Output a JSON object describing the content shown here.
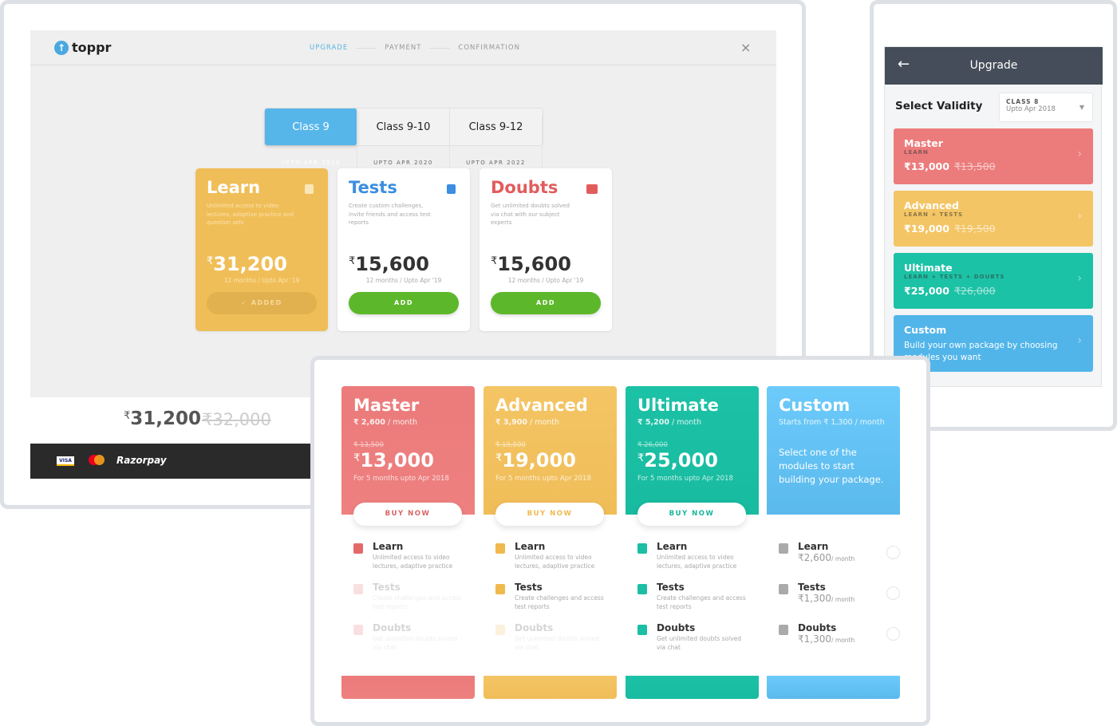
{
  "colors": {
    "master": "#ec7b7b",
    "advanced": "#f2c15e",
    "ultimate": "#1cc2a6",
    "custom": "#5cbdf0",
    "add_green": "#5cb82a",
    "accent_blue": "#56b6ea",
    "mobile_header": "#444d59"
  },
  "desktop": {
    "logo": "toppr",
    "steps": [
      {
        "label": "UPGRADE",
        "active": true
      },
      {
        "label": "PAYMENT",
        "active": false
      },
      {
        "label": "CONFIRMATION",
        "active": false
      }
    ],
    "close_icon": "×",
    "class_tabs": [
      {
        "title": "Class 9",
        "subtitle": "UPTO APR 2019",
        "selected": true
      },
      {
        "title": "Class 9-10",
        "subtitle": "UPTO APR 2020",
        "selected": false
      },
      {
        "title": "Class 9-12",
        "subtitle": "UPTO APR 2022",
        "selected": false
      }
    ],
    "modules": [
      {
        "title": "Learn",
        "icon": "book-icon",
        "description": "Unlimited access to video lectures, adaptive practice and question sets",
        "currency": "₹",
        "price": "31,200",
        "duration": "12 months / Upto Apr '19",
        "button": "✓ ADDED"
      },
      {
        "title": "Tests",
        "icon": "test-icon",
        "description": "Create custom challenges, invite friends and access test reports",
        "currency": "₹",
        "price": "15,600",
        "duration": "12 months / Upto Apr '19",
        "button": "ADD"
      },
      {
        "title": "Doubts",
        "icon": "chat-icon",
        "description": "Get unlimited doubts solved via chat with our subject experts",
        "currency": "₹",
        "price": "15,600",
        "duration": "12 months / Upto Apr '19",
        "button": "ADD"
      }
    ],
    "total": {
      "currency": "₹",
      "price": "31,200",
      "original": "₹32,000"
    },
    "payment": {
      "visa": "VISA",
      "razorpay": "Razorpay"
    }
  },
  "mobile": {
    "back_icon": "←",
    "title": "Upgrade",
    "select_label": "Select Validity",
    "dropdown": {
      "class": "CLASS 8",
      "validity": "Upto Apr 2018"
    },
    "packages": [
      {
        "name": "Master",
        "modules": "LEARN",
        "price": "₹13,000",
        "original": "₹13,500"
      },
      {
        "name": "Advanced",
        "modules": "LEARN + TESTS",
        "price": "₹19,000",
        "original": "₹19,500"
      },
      {
        "name": "Ultimate",
        "modules": "LEARN + TESTS + DOUBTS",
        "price": "₹25,000",
        "original": "₹26,000"
      },
      {
        "name": "Custom",
        "description": "Build your own package by choosing modules you want"
      }
    ]
  },
  "plans": [
    {
      "name": "Master",
      "monthly": "₹ 2,600",
      "per": " / month",
      "original": "₹ 13,500",
      "currency": "₹",
      "price": "13,000",
      "period": "For 5 months upto Apr 2018",
      "button": "BUY NOW",
      "features": [
        {
          "title": "Learn",
          "desc": "Unlimited access to video lectures, adaptive practice",
          "included": true
        },
        {
          "title": "Tests",
          "desc": "Create challenges and access test reports",
          "included": false
        },
        {
          "title": "Doubts",
          "desc": "Get unlimited doubts solved via chat",
          "included": false
        }
      ]
    },
    {
      "name": "Advanced",
      "monthly": "₹ 3,900",
      "per": " / month",
      "original": "₹ 19,500",
      "currency": "₹",
      "price": "19,000",
      "period": "For 5 months upto Apr 2018",
      "button": "BUY NOW",
      "features": [
        {
          "title": "Learn",
          "desc": "Unlimited access to video lectures, adaptive practice",
          "included": true
        },
        {
          "title": "Tests",
          "desc": "Create challenges and access test reports",
          "included": true
        },
        {
          "title": "Doubts",
          "desc": "Get unlimited doubts solved via chat",
          "included": false
        }
      ]
    },
    {
      "name": "Ultimate",
      "monthly": "₹ 5,200",
      "per": " / month",
      "original": "₹ 26,000",
      "currency": "₹",
      "price": "25,000",
      "period": "For 5 months upto Apr 2018",
      "button": "BUY NOW",
      "features": [
        {
          "title": "Learn",
          "desc": "Unlimited access to video lectures, adaptive practice",
          "included": true
        },
        {
          "title": "Tests",
          "desc": "Create challenges and access test reports",
          "included": true
        },
        {
          "title": "Doubts",
          "desc": "Get unlimited doubts solved via chat",
          "included": true
        }
      ]
    },
    {
      "name": "Custom",
      "starts": "Starts from ₹ 1,300 / month",
      "description": "Select one of the modules to start building your package.",
      "features": [
        {
          "title": "Learn",
          "price": "₹2,600",
          "per": "/ month"
        },
        {
          "title": "Tests",
          "price": "₹1,300",
          "per": "/ month"
        },
        {
          "title": "Doubts",
          "price": "₹1,300",
          "per": "/ month"
        }
      ]
    }
  ]
}
